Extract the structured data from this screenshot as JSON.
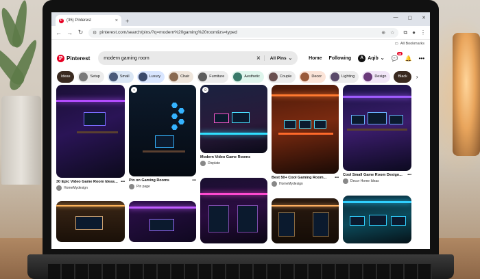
{
  "browser": {
    "tab_title": "(35) Pinterest",
    "tab_close": "×",
    "new_tab": "+",
    "url": "pinterest.com/search/pins/?q=modern%20gaming%20room&rs=typed",
    "bookmarks_label": "All Bookmarks"
  },
  "pinterest": {
    "logo_text": "Pinterest",
    "search_value": "modern gaming room",
    "search_clear": "×",
    "scope": "All Pins",
    "nav_home": "Home",
    "nav_following": "Following",
    "account_initial": "A",
    "account_name": "Aqib",
    "notifications_badge": "35",
    "brand_color": "#e60023"
  },
  "chips": [
    {
      "label": "Ideas",
      "dark": true
    },
    {
      "label": "Setup",
      "bg": "#ececec",
      "thumb": "#7a7a7a"
    },
    {
      "label": "Small",
      "bg": "#dbe7f5",
      "thumb": "#4a5a7a"
    },
    {
      "label": "Luxury",
      "bg": "#d9e6ff",
      "thumb": "#3b4a6b"
    },
    {
      "label": "Chair",
      "bg": "#efe6dc",
      "thumb": "#8a6a50"
    },
    {
      "label": "Furniture",
      "bg": "#ececec",
      "thumb": "#5c5c5c"
    },
    {
      "label": "Aesthetic",
      "bg": "#dff5ec",
      "thumb": "#3a7a6a"
    },
    {
      "label": "Couple",
      "bg": "#ececec",
      "thumb": "#6a5050"
    },
    {
      "label": "Decor",
      "bg": "#fbe4d8",
      "thumb": "#9a5a3a"
    },
    {
      "label": "Lighting",
      "bg": "#ececec",
      "thumb": "#5a4a6a"
    },
    {
      "label": "Design",
      "bg": "#f1e6f7",
      "thumb": "#6a3a7a"
    },
    {
      "label": "Black",
      "dark": true
    }
  ],
  "pins": [
    {
      "title": "30 Epic Video Game Room Ideas...",
      "source": "HomeMydesign",
      "more": "•••"
    },
    {
      "title": "Pin on Gaming Rooms",
      "source": "Pin page",
      "more": "•••"
    },
    {
      "title": "Modern Video Game Rooms",
      "source": "Displate",
      "more": ""
    },
    {
      "title": "Best 50+ Cool Gaming Room...",
      "source": "HomeMydesign",
      "more": "•••"
    },
    {
      "title": "Cool Small Game Room Design...",
      "source": "Decor Home Ideas",
      "more": "•••"
    }
  ],
  "help_label": "?"
}
